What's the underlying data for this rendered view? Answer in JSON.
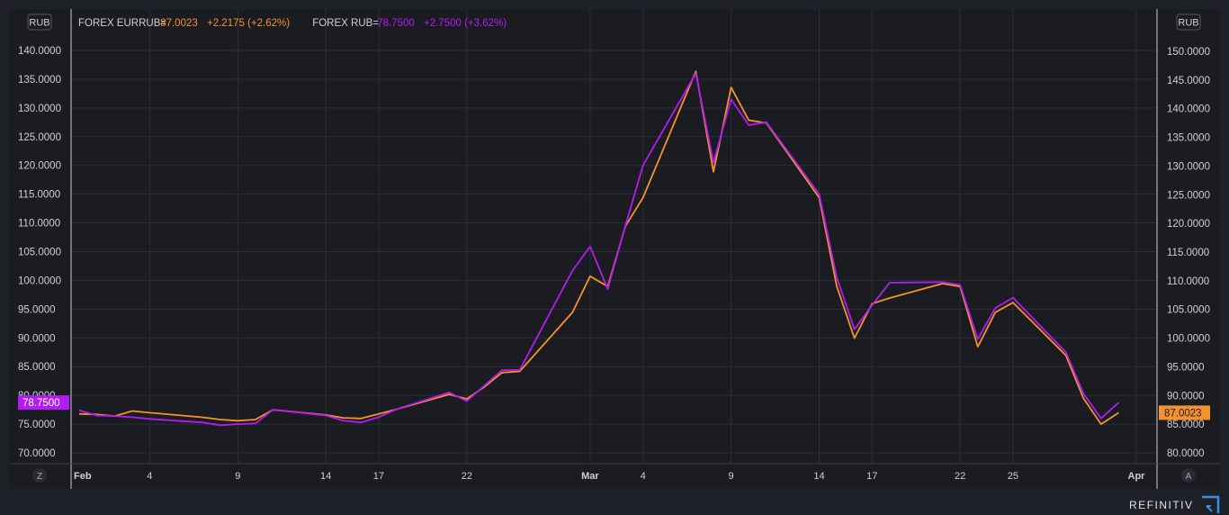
{
  "chart_data": {
    "type": "line",
    "left_axis": {
      "unit_badge": "RUB",
      "ticks": [
        "70.0000",
        "75.0000",
        "80.0000",
        "85.0000",
        "90.0000",
        "95.0000",
        "100.0000",
        "105.0000",
        "110.0000",
        "115.0000",
        "120.0000",
        "125.0000",
        "130.0000",
        "135.0000",
        "140.0000"
      ],
      "range": [
        68.5,
        143
      ],
      "corner_label": "Z"
    },
    "right_axis": {
      "unit_badge": "RUB",
      "ticks": [
        "80.0000",
        "85.0000",
        "90.0000",
        "95.0000",
        "100.0000",
        "105.0000",
        "110.0000",
        "115.0000",
        "120.0000",
        "125.0000",
        "130.0000",
        "135.0000",
        "140.0000",
        "145.0000",
        "150.0000"
      ],
      "range": [
        79.5,
        152.5
      ],
      "corner_label": "A"
    },
    "x_axis": {
      "ticks": [
        {
          "label": "Feb",
          "date": "2022-02-01",
          "bold": true
        },
        {
          "label": "4",
          "date": "2022-02-04"
        },
        {
          "label": "9",
          "date": "2022-02-09"
        },
        {
          "label": "14",
          "date": "2022-02-14"
        },
        {
          "label": "17",
          "date": "2022-02-17"
        },
        {
          "label": "22",
          "date": "2022-02-22"
        },
        {
          "label": "Mar",
          "date": "2022-03-01",
          "bold": true
        },
        {
          "label": "4",
          "date": "2022-03-04"
        },
        {
          "label": "9",
          "date": "2022-03-09"
        },
        {
          "label": "14",
          "date": "2022-03-14"
        },
        {
          "label": "17",
          "date": "2022-03-17"
        },
        {
          "label": "22",
          "date": "2022-03-22"
        },
        {
          "label": "25",
          "date": "2022-03-25"
        },
        {
          "label": "Apr",
          "date": "2022-04-01",
          "bold": true
        }
      ]
    },
    "grid": true,
    "legend_position": "top-left",
    "dates": [
      "2022-01-31",
      "2022-02-01",
      "2022-02-02",
      "2022-02-03",
      "2022-02-04",
      "2022-02-07",
      "2022-02-08",
      "2022-02-09",
      "2022-02-10",
      "2022-02-11",
      "2022-02-14",
      "2022-02-15",
      "2022-02-16",
      "2022-02-17",
      "2022-02-18",
      "2022-02-21",
      "2022-02-22",
      "2022-02-23",
      "2022-02-24",
      "2022-02-25",
      "2022-02-28",
      "2022-03-01",
      "2022-03-02",
      "2022-03-03",
      "2022-03-04",
      "2022-03-07",
      "2022-03-08",
      "2022-03-09",
      "2022-03-10",
      "2022-03-11",
      "2022-03-14",
      "2022-03-15",
      "2022-03-16",
      "2022-03-17",
      "2022-03-18",
      "2022-03-21",
      "2022-03-22",
      "2022-03-23",
      "2022-03-24",
      "2022-03-25",
      "2022-03-28",
      "2022-03-29",
      "2022-03-30",
      "2022-03-31"
    ],
    "series": [
      {
        "name": "FOREX EURRUB=",
        "legend_value": "87.0023",
        "legend_change": "+2.2175 (+2.62%)",
        "last_value_label": "87.0023",
        "axis": "right",
        "color": "#f5922f",
        "values": [
          86.8,
          86.7,
          86.4,
          87.3,
          87.0,
          86.2,
          85.8,
          85.6,
          85.8,
          87.5,
          86.6,
          86.1,
          86.0,
          86.8,
          87.6,
          90.2,
          89.4,
          91.5,
          94.0,
          94.2,
          104.5,
          110.8,
          109.0,
          119.5,
          124.5,
          146.5,
          129.0,
          143.7,
          138.0,
          137.5,
          124.5,
          109.0,
          100.0,
          106.0,
          107.0,
          109.5,
          109.0,
          98.5,
          104.5,
          106.2,
          97.0,
          89.5,
          85.0,
          87.0
        ]
      },
      {
        "name": "FOREX RUB=",
        "legend_value": "78.7500",
        "legend_change": "+2.7500 (+3.62%)",
        "last_value_label": "78.7500",
        "axis": "left",
        "color": "#b21cf2",
        "values": [
          77.4,
          76.5,
          76.4,
          76.2,
          75.9,
          75.3,
          74.8,
          75.0,
          75.1,
          77.5,
          76.5,
          75.6,
          75.3,
          76.2,
          77.6,
          80.5,
          79.0,
          81.7,
          84.4,
          84.4,
          101.7,
          105.9,
          98.5,
          109.5,
          120.0,
          136.0,
          120.5,
          131.5,
          127.0,
          127.5,
          115.0,
          100.5,
          91.5,
          95.7,
          99.6,
          99.7,
          99.2,
          89.8,
          95.2,
          97.0,
          87.5,
          80.3,
          76.0,
          78.75
        ]
      }
    ]
  },
  "branding": {
    "text": "REFINITIV"
  }
}
